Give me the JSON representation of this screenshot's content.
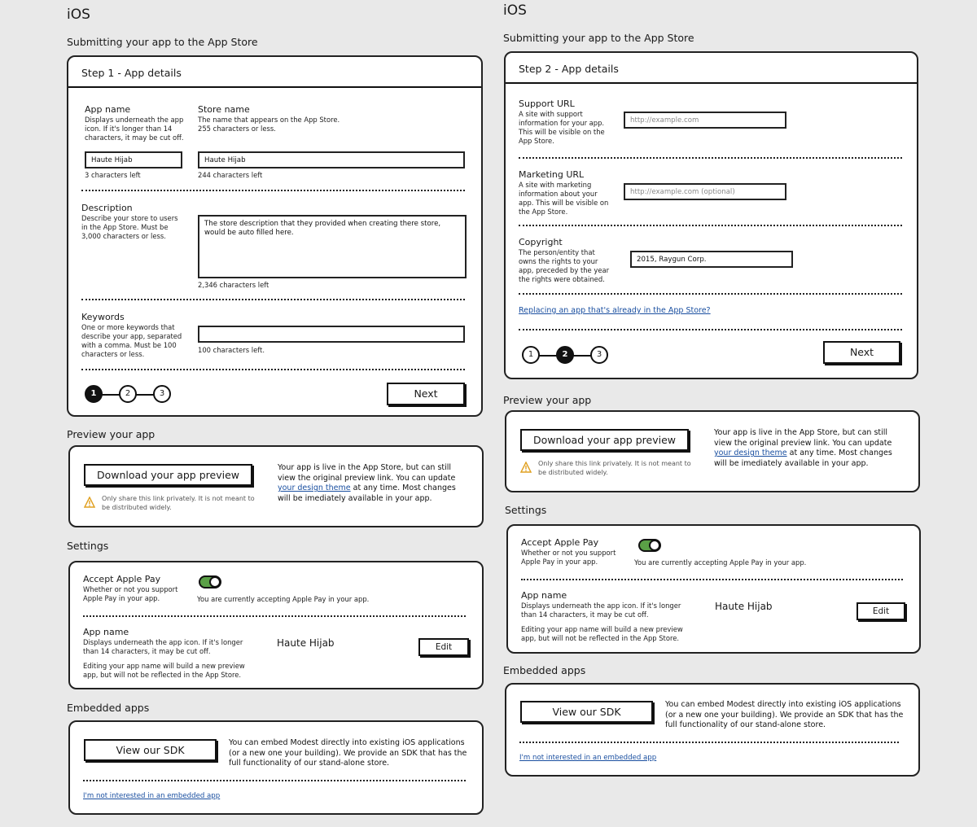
{
  "left": {
    "platform": "iOS",
    "submit_heading": "Submitting your app to the App Store",
    "step_title": "Step 1 - App details",
    "app_name_label": "App name",
    "app_name_hint": "Displays underneath the app icon. If it's longer than 14 characters, it may be cut off.",
    "app_name_value": "Haute Hijab",
    "app_name_count": "3 characters left",
    "store_name_label": "Store name",
    "store_name_hint": "The name that appears on the App Store. 255 characters or less.",
    "store_name_value": "Haute Hijab",
    "store_name_count": "244 characters left",
    "description_label": "Description",
    "description_hint": "Describe your store to users in the App Store. Must be 3,000 characters or less.",
    "description_value": "The store description that they provided when creating there store, would be auto filled here.",
    "description_count": "2,346 characters left",
    "keywords_label": "Keywords",
    "keywords_hint": "One or more keywords that describe your app, separated with a comma. Must be 100 characters or less.",
    "keywords_value": "",
    "keywords_count": "100 characters left.",
    "steps": [
      "1",
      "2",
      "3"
    ],
    "active_step": 1,
    "next_label": "Next",
    "preview_heading": "Preview your app",
    "download_label": "Download your app preview",
    "preview_warning": "Only share this link privately. It is not meant to be distributed widely.",
    "preview_text_before": "Your app is live in the App Store, but can still view the original preview link. You can update ",
    "preview_link": "your design theme",
    "preview_text_after": " at any time. Most changes will be imediately available in your app.",
    "settings_heading": "Settings",
    "apple_pay_label": "Accept Apple Pay",
    "apple_pay_hint": "Whether or not you support Apple Pay in your app.",
    "apple_pay_status": "You are currently accepting Apple Pay in your app.",
    "setting_app_name_label": "App name",
    "setting_app_name_hint": "Displays underneath the app icon. If it's longer than 14 characters, it may be cut off.",
    "setting_app_name_note": "Editing your app name will build a new preview app, but will not be reflected in the App Store.",
    "setting_app_name_value": "Haute Hijab",
    "edit_label": "Edit",
    "embedded_heading": "Embedded apps",
    "sdk_label": "View our SDK",
    "sdk_text": "You can embed Modest directly into existing iOS applications (or a new one your building). We provide an SDK that has the full functionality of our stand-alone store.",
    "not_interested": "I'm not interested in an embedded app"
  },
  "right": {
    "platform": "iOS",
    "submit_heading": "Submitting your app to the App Store",
    "step_title": "Step 2 - App details",
    "support_url_label": "Support URL",
    "support_url_hint": "A site with support information for your app. This will be visible on the App Store.",
    "support_url_placeholder": "http://example.com",
    "marketing_url_label": "Marketing URL",
    "marketing_url_hint": "A site with marketing information about your app. This will be visible on the App Store.",
    "marketing_url_placeholder": "http://example.com (optional)",
    "copyright_label": "Copyright",
    "copyright_hint": "The person/entity that owns the rights to your app, preceded by the year the rights were obtained.",
    "copyright_value": "2015, Raygun Corp.",
    "replacing_link": "Replacing an app that's already in the App Store?",
    "steps": [
      "1",
      "2",
      "3"
    ],
    "active_step": 2,
    "next_label": "Next",
    "preview_heading": "Preview your app",
    "download_label": "Download your app preview",
    "preview_warning": "Only share this link privately. It is not meant to be distributed widely.",
    "preview_text_before": "Your app is live in the App Store, but can still view the original preview link. You can update ",
    "preview_link": "your design theme",
    "preview_text_after": " at any time. Most changes will be imediately available in your app.",
    "settings_heading": "Settings",
    "apple_pay_label": "Accept Apple Pay",
    "apple_pay_hint": "Whether or not you support Apple Pay in your app.",
    "apple_pay_status": "You are currently accepting Apple Pay in your app.",
    "setting_app_name_label": "App name",
    "setting_app_name_hint": "Displays underneath the app icon. If it's longer than 14 characters, it may be cut off.",
    "setting_app_name_note": "Editing your app name will build a new preview app, but will not be reflected in the App Store.",
    "setting_app_name_value": "Haute Hijab",
    "edit_label": "Edit",
    "embedded_heading": "Embedded apps",
    "sdk_label": "View our SDK",
    "sdk_text": "You can embed Modest directly into existing iOS applications (or a new one your building). We provide an SDK that has the full functionality of our stand-alone store.",
    "not_interested": "I'm not interested in an embedded app"
  },
  "colors": {
    "toggle_on": "#5aa046",
    "link": "#1a4fa0",
    "warning": "#e0a020"
  },
  "icons": {
    "warning": "warning-icon"
  }
}
